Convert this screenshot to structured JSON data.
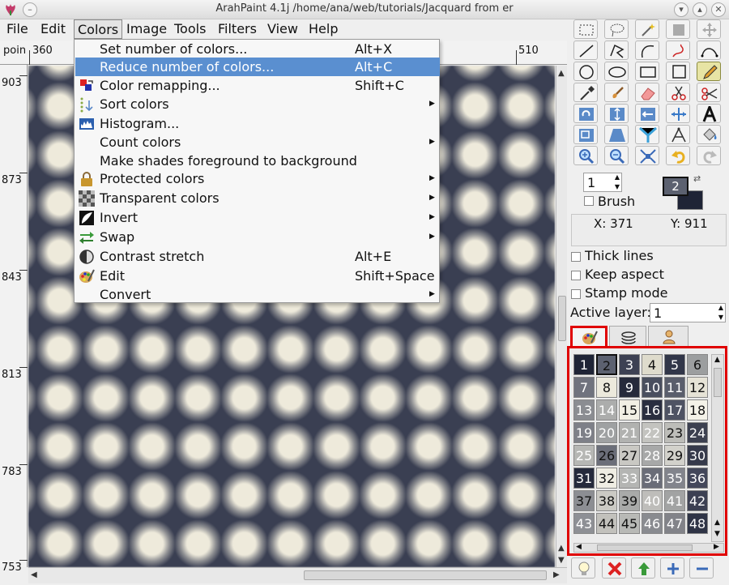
{
  "window": {
    "title": "ArahPaint 4.1j /home/ana/web/tutorials/Jacquard from er"
  },
  "menubar": [
    "File",
    "Edit",
    "Colors",
    "Image",
    "Tools",
    "Filters",
    "View",
    "Help"
  ],
  "ruler": {
    "mode_label": "poin",
    "x_labels": [
      "360",
      "510"
    ],
    "y_labels": [
      "903",
      "873",
      "843",
      "813",
      "783",
      "753"
    ]
  },
  "colors_menu": [
    {
      "label": "Set number of colors...",
      "shortcut": "Alt+X",
      "icon": "",
      "submenu": false
    },
    {
      "label": "Reduce number of colors...",
      "shortcut": "Alt+C",
      "icon": "",
      "submenu": false,
      "highlighted": true
    },
    {
      "label": "Color remapping...",
      "shortcut": "Shift+C",
      "icon": "color-remap-icon",
      "submenu": false
    },
    {
      "label": "Sort colors",
      "shortcut": "",
      "icon": "sort-icon",
      "submenu": true
    },
    {
      "label": "Histogram...",
      "shortcut": "",
      "icon": "histogram-icon",
      "submenu": false
    },
    {
      "label": "Count colors",
      "shortcut": "",
      "icon": "",
      "submenu": true
    },
    {
      "label": "Make shades foreground to background",
      "shortcut": "",
      "icon": "",
      "submenu": false
    },
    {
      "label": "Protected colors",
      "shortcut": "",
      "icon": "lock-icon",
      "submenu": true
    },
    {
      "label": "Transparent colors",
      "shortcut": "",
      "icon": "checker-icon",
      "submenu": true
    },
    {
      "label": "Invert",
      "shortcut": "",
      "icon": "invert-icon",
      "submenu": true
    },
    {
      "label": "Swap",
      "shortcut": "",
      "icon": "swap-icon",
      "submenu": true
    },
    {
      "label": "Contrast stretch",
      "shortcut": "Alt+E",
      "icon": "contrast-icon",
      "submenu": false
    },
    {
      "label": "Edit",
      "shortcut": "Shift+Space",
      "icon": "palette-icon",
      "submenu": false
    },
    {
      "label": "Convert",
      "shortcut": "",
      "icon": "",
      "submenu": true
    }
  ],
  "side_panel": {
    "brush_size": "1",
    "brush_label": "Brush",
    "color_index": "2",
    "coord_x": "X: 371",
    "coord_y": "Y: 911",
    "thick_lines": "Thick lines",
    "keep_aspect": "Keep aspect",
    "stamp_mode": "Stamp mode",
    "active_layer_label": "Active layer:",
    "active_layer_value": "1"
  },
  "palette": {
    "colors": [
      "#1f2436",
      "#5c6170",
      "#3d4153",
      "#dedbcc",
      "#313649",
      "#9c9e9f",
      "#70737e",
      "#ece9dc",
      "#262a3b",
      "#4a4f5f",
      "#5a5e6c",
      "#e6e3d6",
      "#8b8d92",
      "#acadac",
      "#f1efe4",
      "#2a2e40",
      "#4f5363",
      "#f4f2e8",
      "#7e8088",
      "#9fa1a2",
      "#b1b2b0",
      "#c3c3bf",
      "#bdbdb9",
      "#3c4050",
      "#b6b7b4",
      "#6b6e79",
      "#c9c8c3",
      "#a7a8a8",
      "#d2d1cb",
      "#363a4b",
      "#252a3c",
      "#efede3",
      "#b4b5b3",
      "#6a6d78",
      "#82848c",
      "#43475a",
      "#8c8e93",
      "#cbcac4",
      "#a9aaa9",
      "#bebdba",
      "#a2a3a3",
      "#3c4052",
      "#8e9095",
      "#c2c1bc",
      "#b8b9b6",
      "#898b90",
      "#828389",
      "#2f3446"
    ],
    "label_colors": [
      "#fff",
      "#111",
      "#fff",
      "#111",
      "#fff",
      "#111",
      "#fff",
      "#111",
      "#fff",
      "#fff",
      "#fff",
      "#111",
      "#fff",
      "#fff",
      "#111",
      "#fff",
      "#fff",
      "#111",
      "#fff",
      "#fff",
      "#fff",
      "#fff",
      "#111",
      "#fff",
      "#fff",
      "#111",
      "#111",
      "#fff",
      "#111",
      "#fff",
      "#fff",
      "#111",
      "#fff",
      "#fff",
      "#fff",
      "#fff",
      "#111",
      "#111",
      "#111",
      "#fff",
      "#fff",
      "#fff",
      "#fff",
      "#111",
      "#111",
      "#fff",
      "#fff",
      "#fff"
    ]
  }
}
